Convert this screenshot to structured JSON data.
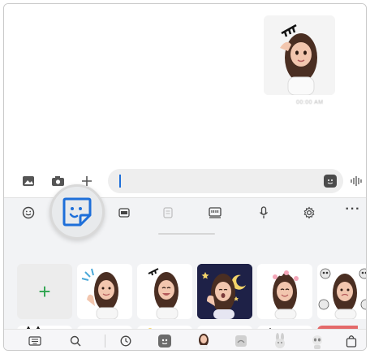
{
  "chat": {
    "sent_sticker": {
      "icon": "ar-emoji-salute-sticker-icon"
    },
    "timestamp": "00:00 AM"
  },
  "composer": {
    "icons": [
      "gallery-icon",
      "camera-icon",
      "plus-icon",
      "voice-wave-icon"
    ],
    "input_value": "",
    "sticker_button_icon": "sticker-icon"
  },
  "keyboard_toolbar": {
    "items": [
      "emoji-icon",
      "sticker-icon",
      "gif-icon",
      "clipboard-icon",
      "keyboard-mode-icon",
      "mic-icon",
      "settings-icon",
      "more-icon"
    ],
    "more_label": "···",
    "highlighted": "sticker-icon"
  },
  "sticker_categories": [
    "",
    "",
    "",
    "",
    ""
  ],
  "sticker_grid": {
    "add_label": "+",
    "items": [
      "salute",
      "wave",
      "laughing",
      "night-yawn",
      "flower-crown",
      "skulls"
    ]
  },
  "bottom_bar": {
    "items": [
      "keyboard-icon",
      "search-icon",
      "recent-icon",
      "sticker-pack-icon",
      "ar-emoji-icon",
      "sticker-pack-2-icon",
      "bunny-icon",
      "panda-icon",
      "store-icon"
    ]
  },
  "colors": {
    "accent": "#1e6fd9",
    "add_plus": "#2ea44f",
    "keyboard_bg": "#f2f3f5"
  }
}
